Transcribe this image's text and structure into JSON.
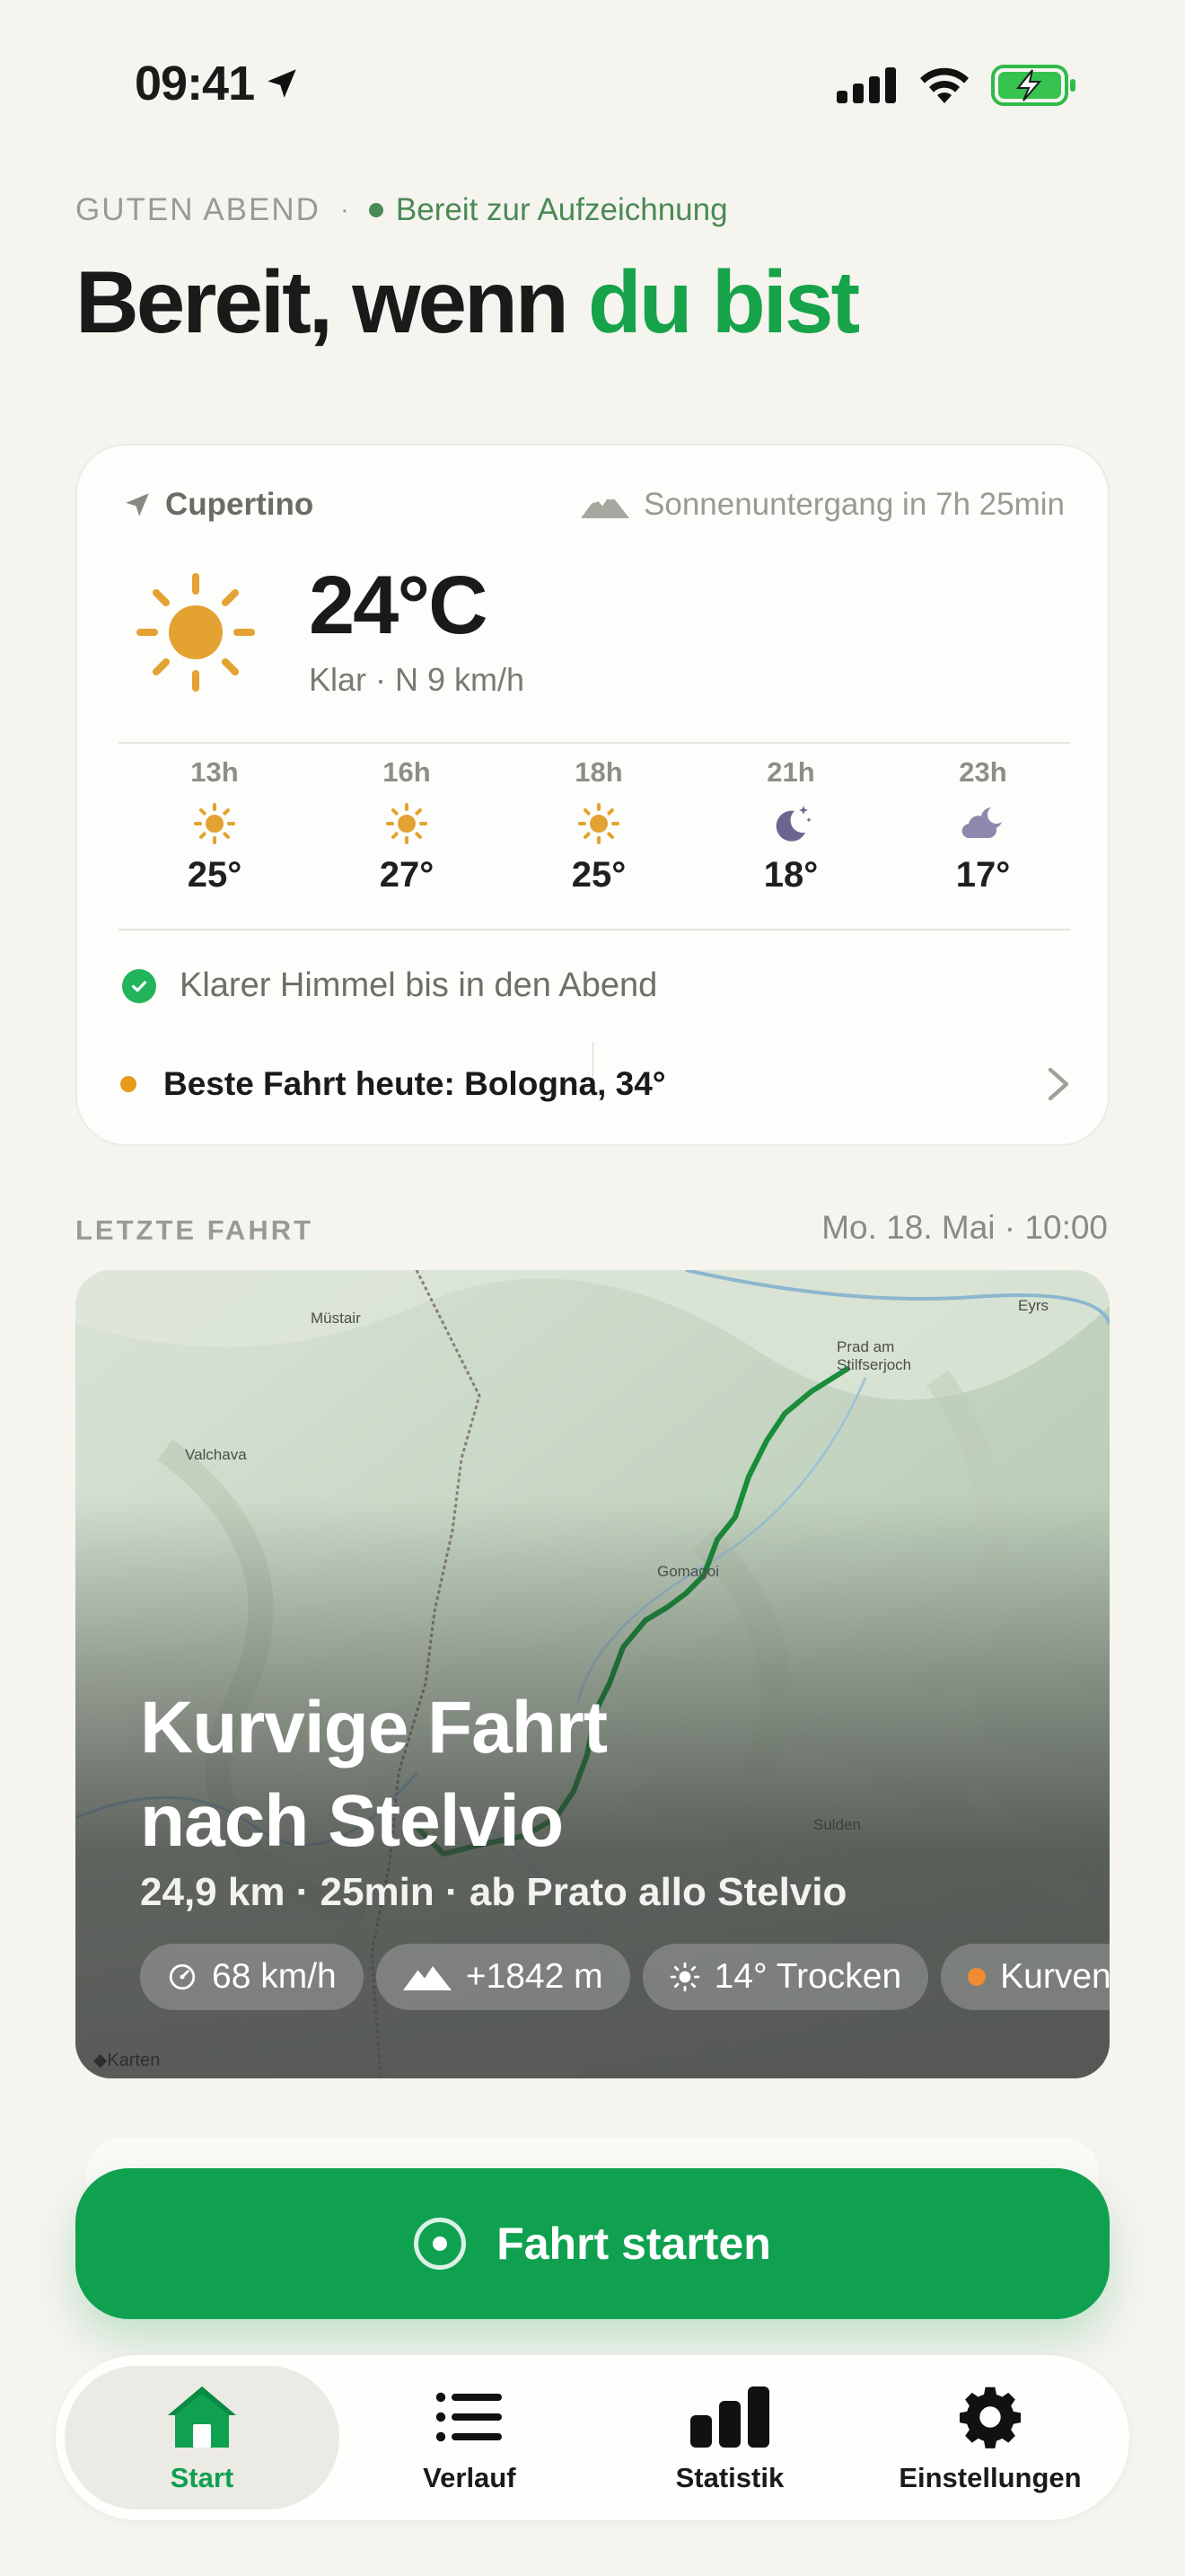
{
  "status_bar": {
    "time": "09:41",
    "icons": [
      "location-arrow-icon",
      "cellular-signal-icon",
      "wifi-icon",
      "battery-charging-icon"
    ]
  },
  "header": {
    "greeting": "GUTEN ABEND",
    "separator": "·",
    "status": "Bereit zur Aufzeichnung",
    "headline_main": "Bereit, wenn ",
    "headline_accent": "du bist"
  },
  "weather": {
    "location": "Cupertino",
    "sunset": "Sonnenuntergang in 7h 25min",
    "current_temp": "24°C",
    "condition": "Klar · N 9 km/h",
    "hourly": [
      {
        "time": "13h",
        "icon": "sun-icon",
        "temp": "25°"
      },
      {
        "time": "16h",
        "icon": "sun-icon",
        "temp": "27°"
      },
      {
        "time": "18h",
        "icon": "sun-icon",
        "temp": "25°"
      },
      {
        "time": "21h",
        "icon": "moon-stars-icon",
        "temp": "18°"
      },
      {
        "time": "23h",
        "icon": "cloud-moon-icon",
        "temp": "17°"
      }
    ],
    "clear_note": "Klarer Himmel bis in den Abend",
    "best_ride": "Beste Fahrt heute: Bologna, 34°"
  },
  "last_ride": {
    "section_label": "LETZTE FAHRT",
    "date": "Mo. 18. Mai · 10:00",
    "title_line1": "Kurvige Fahrt",
    "title_line2": "nach Stelvio",
    "subtitle": "24,9 km · 25min · ab Prato allo Stelvio",
    "chips": [
      {
        "icon": "speedometer-icon",
        "label": "68 km/h"
      },
      {
        "icon": "mountain-icon",
        "label": "+1842 m"
      },
      {
        "icon": "sun-icon",
        "label": "14° Trocken"
      },
      {
        "icon": "orange-dot",
        "label": "Kurven"
      }
    ],
    "map_places": {
      "mustair": "Müstair",
      "valchava": "Valchava",
      "prato1": "Prad am",
      "prato2": "Stilfserjoch",
      "eyrs": "Eyrs",
      "gomagoi": "Gomagoi",
      "sulden": "Sulden"
    },
    "map_attribution": "Karten"
  },
  "start_button": {
    "label": "Fahrt starten"
  },
  "tab_bar": {
    "items": [
      {
        "label": "Start",
        "icon": "home-icon",
        "active": true
      },
      {
        "label": "Verlauf",
        "icon": "list-icon",
        "active": false
      },
      {
        "label": "Statistik",
        "icon": "bar-chart-icon",
        "active": false
      },
      {
        "label": "Einstellungen",
        "icon": "gear-icon",
        "active": false
      }
    ]
  },
  "colors": {
    "accent_green": "#16a34a",
    "button_green": "#0fa150",
    "sun_orange": "#e3a232",
    "moon_purple": "#6b6690",
    "background": "#f6f4ef"
  }
}
